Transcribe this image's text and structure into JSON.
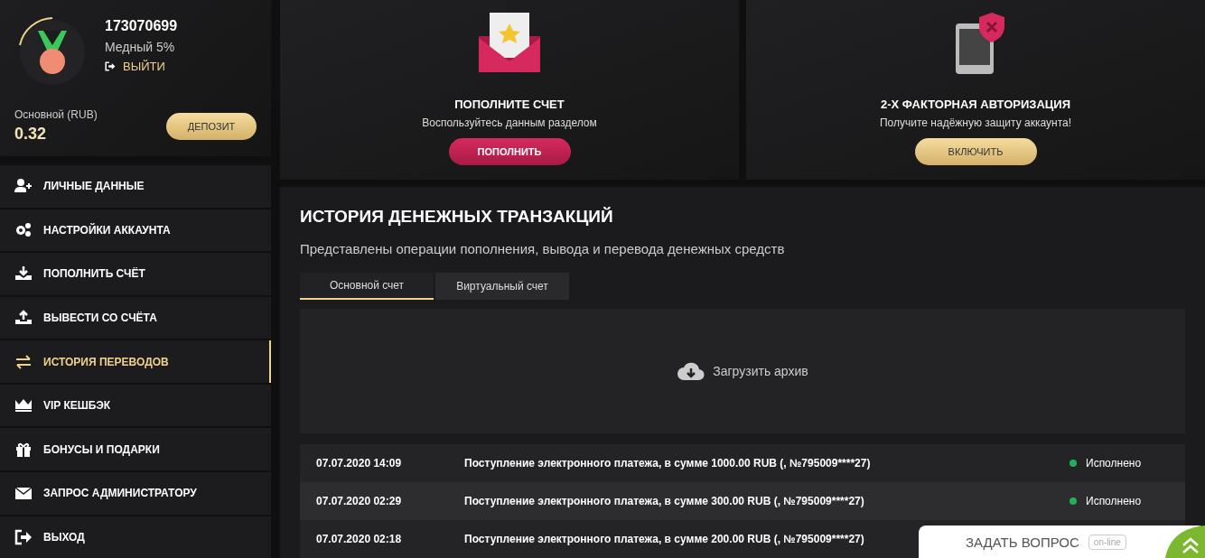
{
  "profile": {
    "user_id": "173070699",
    "level": "Медный 5%",
    "logout": "ВЫЙТИ",
    "balance_label": "Основной (RUB)",
    "balance": "0.32",
    "deposit_button": "ДЕПОЗИТ"
  },
  "menu": [
    {
      "label": "ЛИЧНЫЕ ДАННЫЕ",
      "selected": false
    },
    {
      "label": "НАСТРОЙКИ АККАУНТА",
      "selected": false
    },
    {
      "label": "ПОПОЛНИТЬ СЧЁТ",
      "selected": false
    },
    {
      "label": "ВЫВЕСТИ СО СЧЁТА",
      "selected": false
    },
    {
      "label": "ИСТОРИЯ ПЕРЕВОДОВ",
      "selected": true
    },
    {
      "label": "VIP КЕШБЭК",
      "selected": false
    },
    {
      "label": "БОНУСЫ И ПОДАРКИ",
      "selected": false
    },
    {
      "label": "ЗАПРОС АДМИНИСТРАТОРУ",
      "selected": false
    },
    {
      "label": "ВЫХОД",
      "selected": false
    }
  ],
  "promo_cards": [
    {
      "kind": "deposit",
      "title": "ПОПОЛНИТЕ СЧЕТ",
      "subtitle": "Воспользуйтесь данным разделом",
      "button": "ПОПОЛНИТЬ"
    },
    {
      "kind": "twofactor",
      "title": "2-Х ФАКТОРНАЯ АВТОРИЗАЦИЯ",
      "subtitle": "Получите надёжную защиту аккаунта!",
      "button": "ВКЛЮЧИТЬ"
    }
  ],
  "history": {
    "title": "ИСТОРИЯ ДЕНЕЖНЫХ ТРАНЗАКЦИЙ",
    "description": "Представлены операции пополнения, вывода и перевода денежных средств",
    "tabs": [
      {
        "label": "Основной счет",
        "selected": true
      },
      {
        "label": "Виртуальный счет",
        "selected": false
      }
    ],
    "archive_button": "Загрузить архив",
    "rows": [
      {
        "date": "07.07.2020 14:09",
        "description": "Поступление электронного платежа, в сумме 1000.00 RUB (, №795009****27)",
        "status": "Исполнено",
        "color": "#1fb25a"
      },
      {
        "date": "07.07.2020 02:29",
        "description": "Поступление электронного платежа, в сумме 300.00 RUB (, №795009****27)",
        "status": "Исполнено",
        "color": "#1fb25a"
      },
      {
        "date": "07.07.2020 02:18",
        "description": "Поступление электронного платежа, в сумме 200.00 RUB (, №795009****27)"
      }
    ]
  },
  "chat_widget": {
    "label": "ЗАДАТЬ ВОПРОС",
    "badge": "on-line"
  }
}
